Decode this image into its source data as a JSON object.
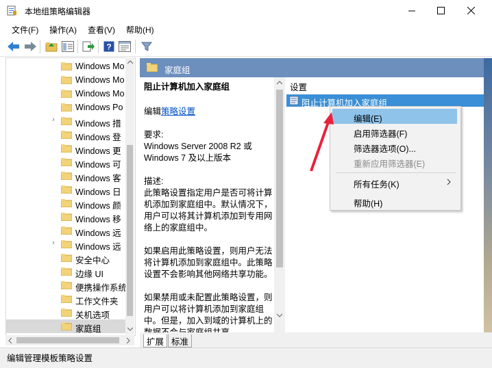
{
  "window": {
    "title": "本地组策略编辑器"
  },
  "menu": [
    "文件(F)",
    "操作(A)",
    "查看(V)",
    "帮助(H)"
  ],
  "tree": {
    "items": [
      {
        "label": "Windows Mo",
        "expandable": false
      },
      {
        "label": "Windows Mo",
        "expandable": false
      },
      {
        "label": "Windows Mo",
        "expandable": false
      },
      {
        "label": "Windows Po",
        "expandable": false
      },
      {
        "label": "Windows 措",
        "expandable": true
      },
      {
        "label": "Windows 登",
        "expandable": false
      },
      {
        "label": "Windows 更",
        "expandable": false
      },
      {
        "label": "Windows 可",
        "expandable": false
      },
      {
        "label": "Windows 客",
        "expandable": false
      },
      {
        "label": "Windows 日",
        "expandable": false
      },
      {
        "label": "Windows 颜",
        "expandable": false
      },
      {
        "label": "Windows 移",
        "expandable": false
      },
      {
        "label": "Windows 远",
        "expandable": false
      },
      {
        "label": "Windows 远",
        "expandable": true
      },
      {
        "label": "安全中心",
        "expandable": false
      },
      {
        "label": "边缘 UI",
        "expandable": false
      },
      {
        "label": "便携操作系统",
        "expandable": false
      },
      {
        "label": "工作文件夹",
        "expandable": false
      },
      {
        "label": "关机选项",
        "expandable": false
      },
      {
        "label": "家庭组",
        "expandable": false,
        "selected": true
      }
    ]
  },
  "pane": {
    "title": "家庭组"
  },
  "description": {
    "policy_title": "阻止计算机加入家庭组",
    "edit_prefix": "编辑",
    "edit_link": "策略设置",
    "requirements_label": "要求:",
    "requirements_lines": [
      "Windows Server 2008 R2 或",
      "Windows 7 及以上版本"
    ],
    "description_label": "描述:",
    "description_lines": [
      "此策略设置指定用户是否可将计算",
      "机添加到家庭组中。默认情况下，",
      "用户可以将其计算机添加到专用网",
      "络上的家庭组中。"
    ],
    "enabled_lines": [
      "如果启用此策略设置，则用户无法",
      "将计算机添加到家庭组中。此策略",
      "设置不会影响其他网络共享功能。"
    ],
    "disabled_lines": [
      "如果禁用或未配置此策略设置，则",
      "用户可以将计算机添加到家庭组",
      "中。但是，加入到域的计算机上的",
      "数据不会与家庭组共享。"
    ]
  },
  "settings": {
    "column_header": "设置",
    "rows": [
      "阻止计算机加入家庭组"
    ]
  },
  "context_menu": {
    "items": [
      {
        "label": "编辑(E)",
        "enabled": true,
        "highlighted": true
      },
      {
        "label": "启用筛选器(F)",
        "enabled": true
      },
      {
        "label": "筛选器选项(O)...",
        "enabled": true
      },
      {
        "label": "重新应用筛选器(E)",
        "enabled": false
      },
      {
        "label": "所有任务(K)",
        "enabled": true,
        "submenu": true
      },
      {
        "label": "帮助(H)",
        "enabled": true
      }
    ]
  },
  "tabs": [
    "扩展",
    "标准"
  ],
  "status": {
    "text": "编辑管理模板策略设置"
  },
  "colors": {
    "header_blue": "#6d8fbd",
    "selection_blue": "#3a8fd6",
    "menu_highlight": "#8fc3ea",
    "arrow_red": "#e8223a"
  }
}
